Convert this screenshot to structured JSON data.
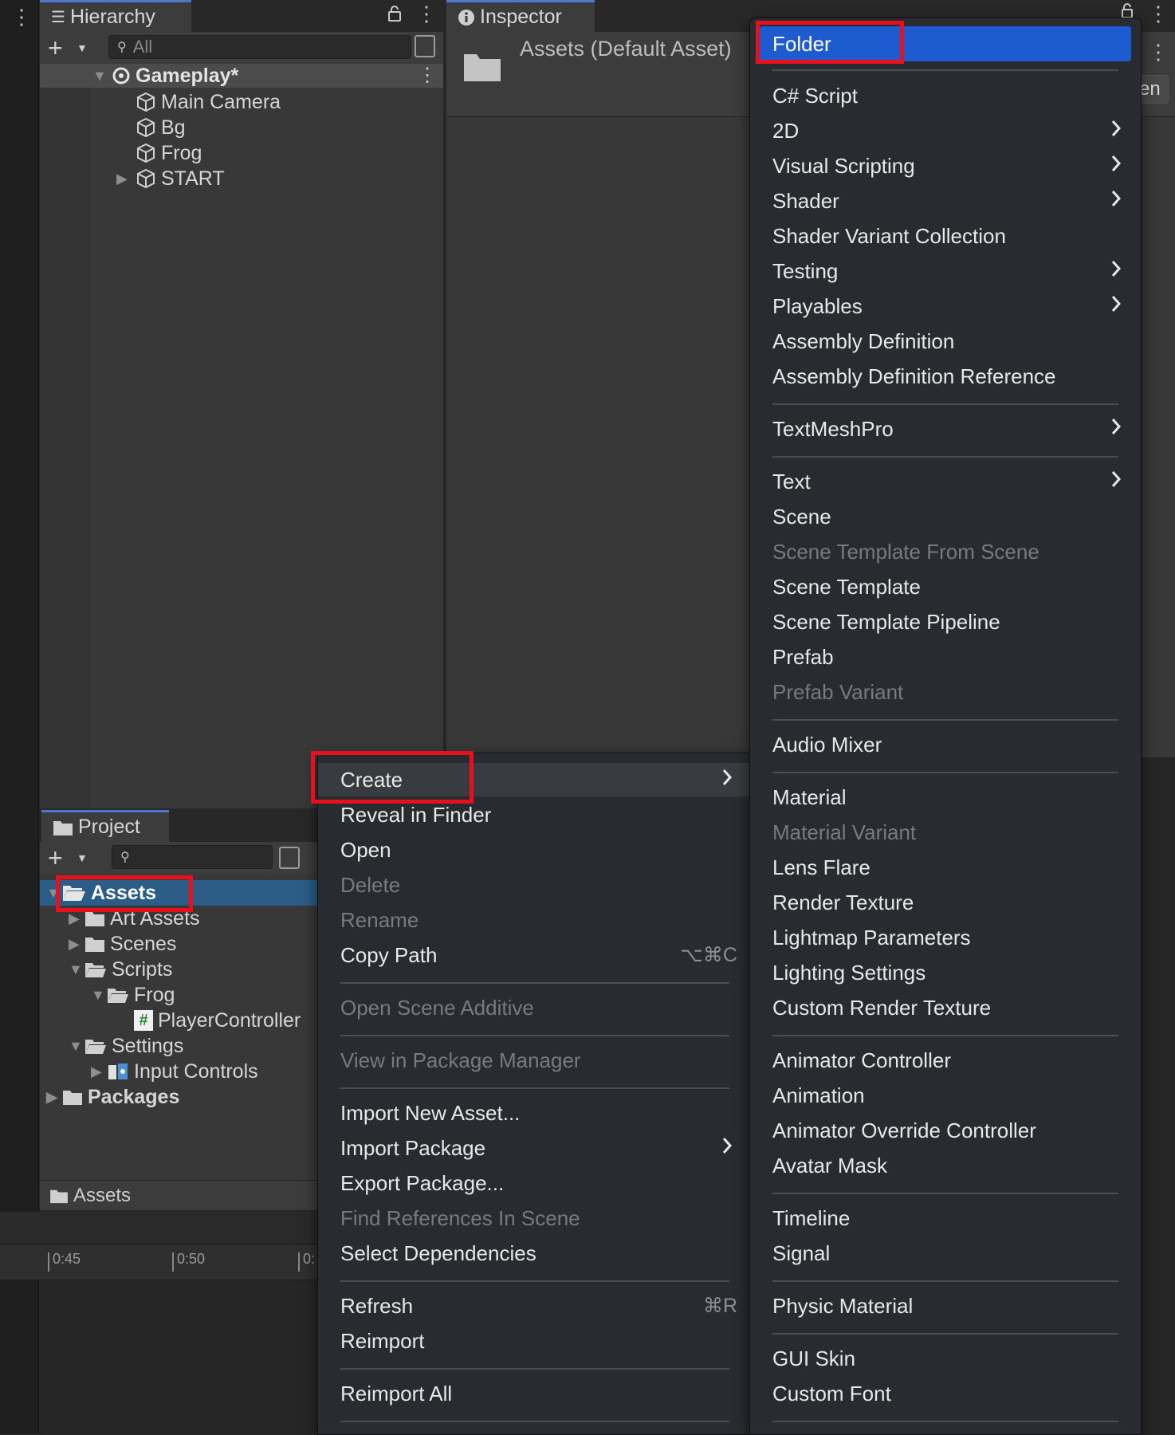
{
  "hierarchy": {
    "tab_label": "Hierarchy",
    "search_placeholder": "All",
    "scene": "Gameplay*",
    "items": [
      {
        "label": "Main Camera"
      },
      {
        "label": "Bg"
      },
      {
        "label": "Frog"
      },
      {
        "label": "START"
      }
    ]
  },
  "inspector": {
    "tab_label": "Inspector",
    "title": "Assets (Default Asset)",
    "partial_button": "en"
  },
  "project": {
    "tab_label": "Project",
    "tree": [
      {
        "label": "Assets"
      },
      {
        "label": "Art Assets"
      },
      {
        "label": "Scenes"
      },
      {
        "label": "Scripts"
      },
      {
        "label": "Frog"
      },
      {
        "label": "PlayerController"
      },
      {
        "label": "Settings"
      },
      {
        "label": "Input Controls"
      },
      {
        "label": "Packages"
      }
    ],
    "footer_path": "Assets"
  },
  "timeline": {
    "ticks": [
      "0:45",
      "0:50",
      "0:"
    ]
  },
  "context_menu": {
    "items": [
      {
        "label": "Create"
      },
      {
        "label": "Reveal in Finder"
      },
      {
        "label": "Open"
      },
      {
        "label": "Delete"
      },
      {
        "label": "Rename"
      },
      {
        "label": "Copy Path",
        "shortcut": "⌥⌘C"
      },
      {
        "label": "Open Scene Additive"
      },
      {
        "label": "View in Package Manager"
      },
      {
        "label": "Import New Asset..."
      },
      {
        "label": "Import Package"
      },
      {
        "label": "Export Package..."
      },
      {
        "label": "Find References In Scene"
      },
      {
        "label": "Select Dependencies"
      },
      {
        "label": "Refresh",
        "shortcut": "⌘R"
      },
      {
        "label": "Reimport"
      },
      {
        "label": "Reimport All"
      }
    ]
  },
  "create_submenu": {
    "items": [
      {
        "label": "Folder"
      },
      {
        "label": "C# Script"
      },
      {
        "label": "2D"
      },
      {
        "label": "Visual Scripting"
      },
      {
        "label": "Shader"
      },
      {
        "label": "Shader Variant Collection"
      },
      {
        "label": "Testing"
      },
      {
        "label": "Playables"
      },
      {
        "label": "Assembly Definition"
      },
      {
        "label": "Assembly Definition Reference"
      },
      {
        "label": "TextMeshPro"
      },
      {
        "label": "Text"
      },
      {
        "label": "Scene"
      },
      {
        "label": "Scene Template From Scene"
      },
      {
        "label": "Scene Template"
      },
      {
        "label": "Scene Template Pipeline"
      },
      {
        "label": "Prefab"
      },
      {
        "label": "Prefab Variant"
      },
      {
        "label": "Audio Mixer"
      },
      {
        "label": "Material"
      },
      {
        "label": "Material Variant"
      },
      {
        "label": "Lens Flare"
      },
      {
        "label": "Render Texture"
      },
      {
        "label": "Lightmap Parameters"
      },
      {
        "label": "Lighting Settings"
      },
      {
        "label": "Custom Render Texture"
      },
      {
        "label": "Animator Controller"
      },
      {
        "label": "Animation"
      },
      {
        "label": "Animator Override Controller"
      },
      {
        "label": "Avatar Mask"
      },
      {
        "label": "Timeline"
      },
      {
        "label": "Signal"
      },
      {
        "label": "Physic Material"
      },
      {
        "label": "GUI Skin"
      },
      {
        "label": "Custom Font"
      }
    ]
  },
  "colors": {
    "highlight_red": "#e8101c",
    "menu_selected_blue": "#1f5bd0",
    "selection_blue": "#2c5d87"
  }
}
